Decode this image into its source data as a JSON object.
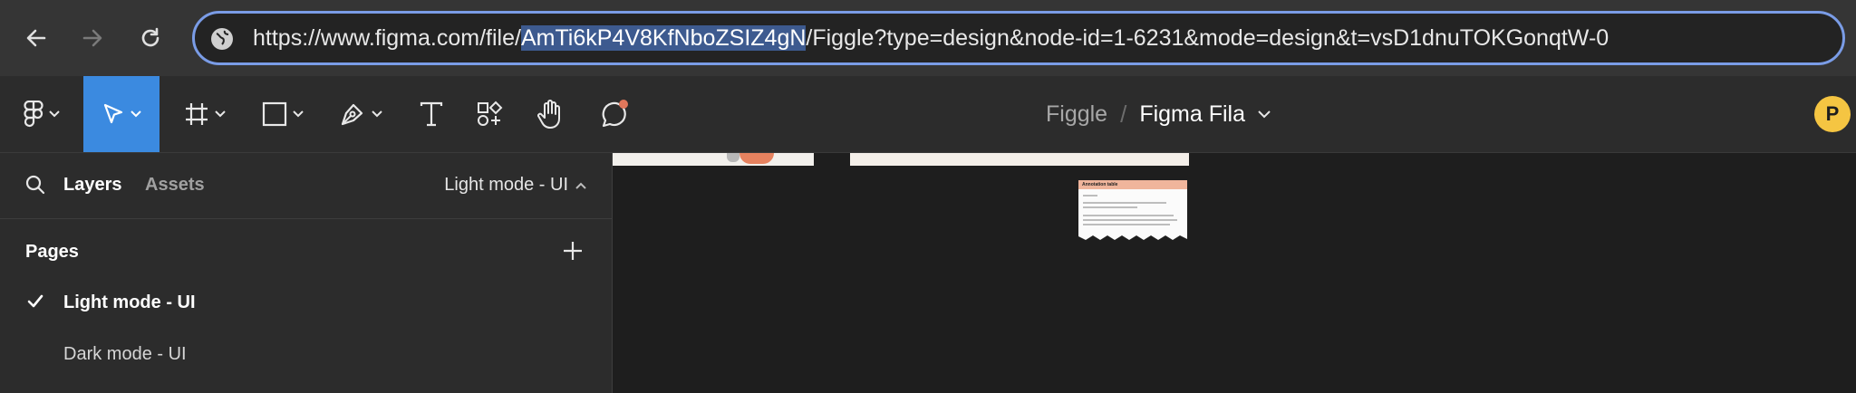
{
  "browser": {
    "url_prefix": "https://www.figma.com/file/",
    "url_highlight": "AmTi6kP4V8KfNboZSIZ4gN",
    "url_suffix": "/Figgle?type=design&node-id=1-6231&mode=design&t=vsD1dnuTOKGonqtW-0"
  },
  "toolbar": {
    "project": "Figgle",
    "separator": "/",
    "file_name": "Figma Fila",
    "avatar_initial": "P"
  },
  "left_panel": {
    "tab_layers": "Layers",
    "tab_assets": "Assets",
    "current_page": "Light mode - UI",
    "pages_title": "Pages",
    "pages": [
      {
        "label": "Light mode - UI",
        "selected": true
      },
      {
        "label": "Dark mode - UI",
        "selected": false
      }
    ]
  },
  "canvas": {
    "note_title": "Annotation table"
  },
  "colors": {
    "accent": "#3b8ae0",
    "url_border": "#7a9ce6",
    "notification_dot": "#e0775b",
    "avatar": "#f5c542"
  }
}
